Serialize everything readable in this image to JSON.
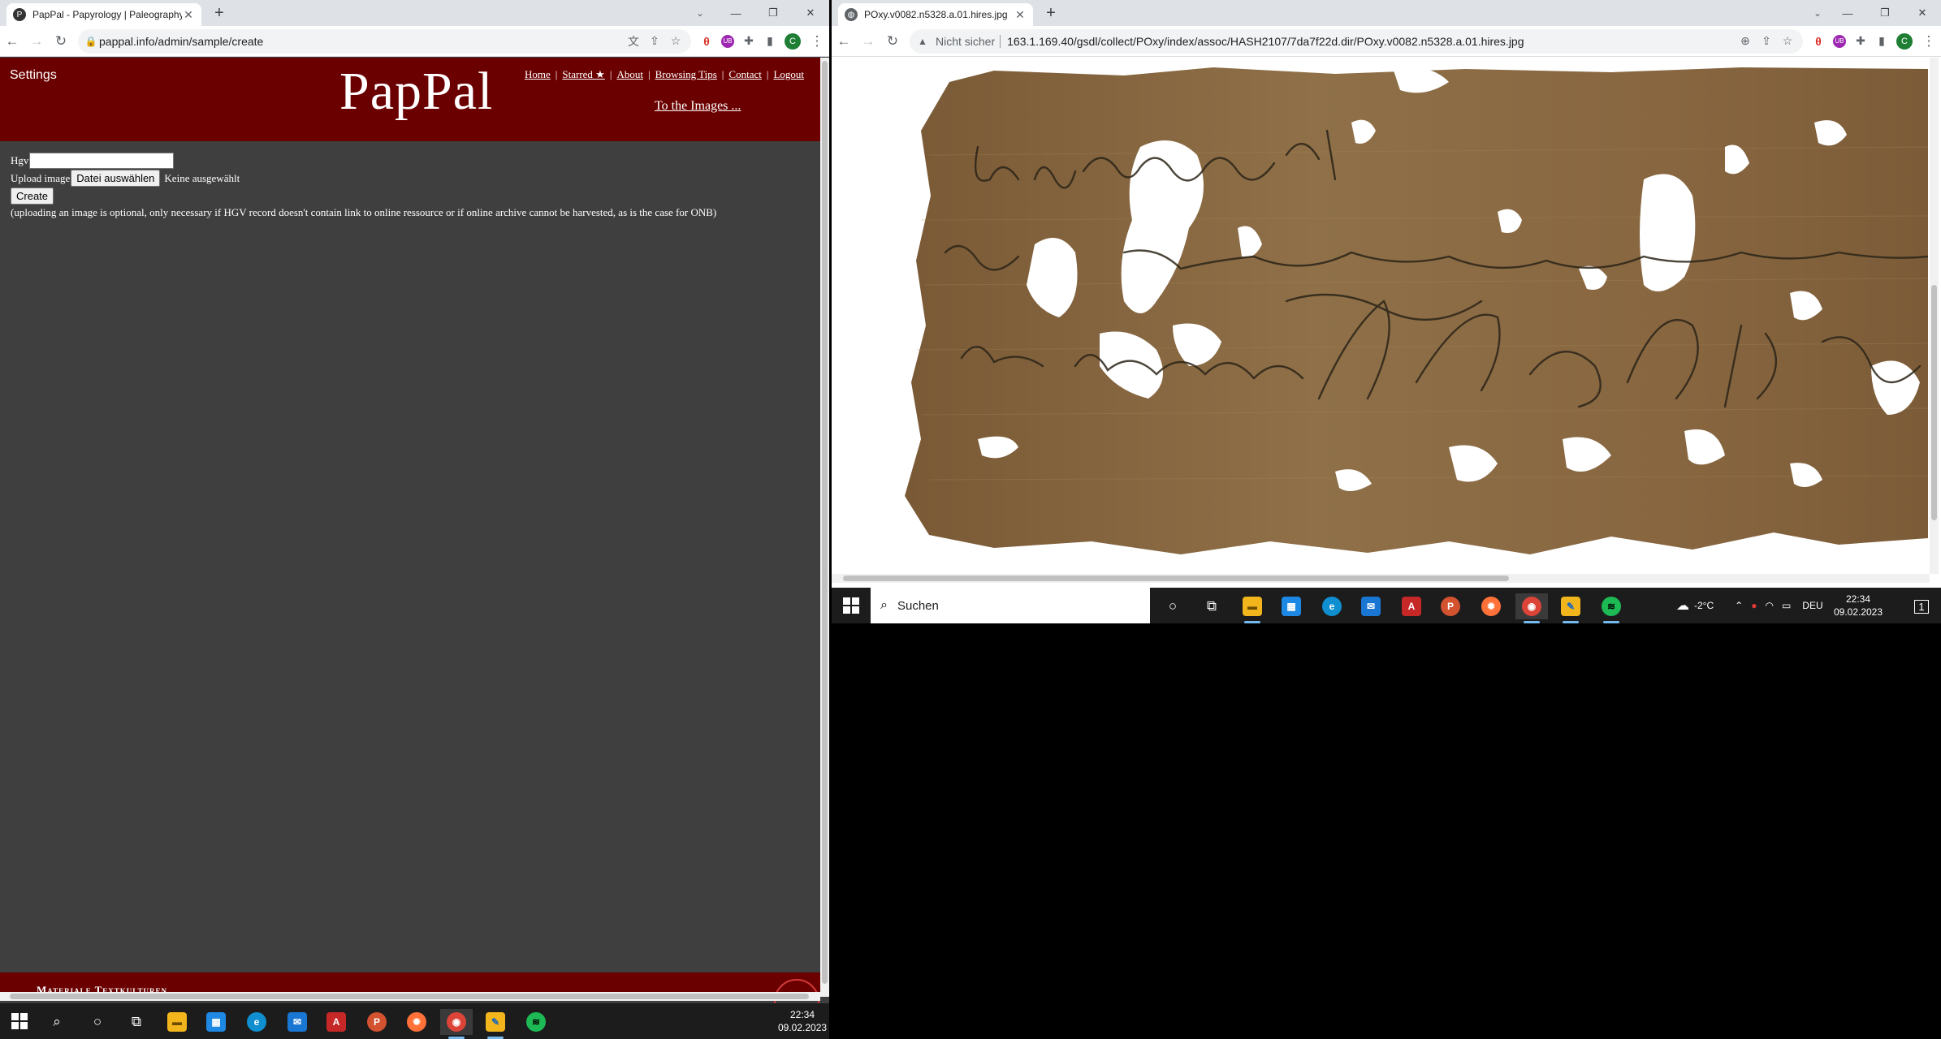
{
  "left_browser": {
    "tab": {
      "title": "PapPal - Papyrology | Paleography"
    },
    "url": "pappal.info/admin/sample/create",
    "page": {
      "settings": "Settings",
      "logo": "PapPal",
      "nav": [
        "Home",
        "Starred ★",
        "About",
        "Browsing Tips",
        "Contact",
        "Logout"
      ],
      "to_images": "To the Images ...",
      "hgv_label": "Hgv",
      "hgv_value": "",
      "upload_label": "Upload image",
      "file_button": "Datei auswählen",
      "file_status": "Keine ausgewählt",
      "create_button": "Create",
      "note": "(uploading an image is optional, only necessary if HGV record doesn't contain link to online ressource or if online archive cannot be harvested, as is the case for ONB)",
      "footer_title": "Materiale Textkulturen"
    }
  },
  "right_browser": {
    "tab": {
      "title": "POxy.v0082.n5328.a.01.hires.jpg"
    },
    "insecure_label": "Nicht sicher",
    "url": "163.1.169.40/gsdl/collect/POxy/index/assoc/HASH2107/7da7f22d.dir/POxy.v0082.n5328.a.01.hires.jpg"
  },
  "taskbar_left": {
    "time": "22:34",
    "date": "09.02.2023"
  },
  "taskbar_right": {
    "search_placeholder": "Suchen",
    "weather": "-2°C",
    "lang": "DEU",
    "time": "22:34",
    "date": "09.02.2023",
    "notification_count": "1"
  },
  "colors": {
    "pappal_red": "#6b0000",
    "page_bg": "#3f3f3f",
    "papyrus": "#8a6a42"
  }
}
